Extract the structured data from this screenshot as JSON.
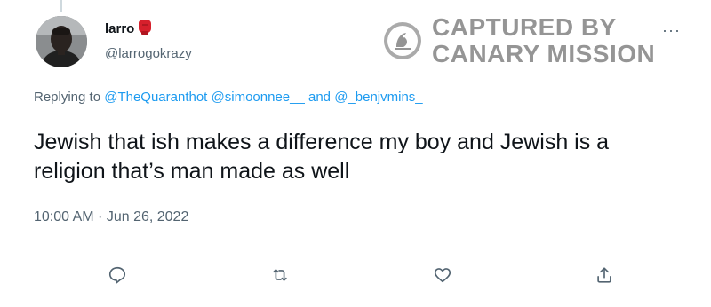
{
  "author": {
    "display_name": "larro",
    "emoji_icon": "boxing-glove-icon",
    "username": "@larrogokrazy"
  },
  "more_menu": {
    "glyph": "···"
  },
  "watermark": {
    "line1": "CAPTURED BY",
    "line2": "CANARY MISSION"
  },
  "reply_context": {
    "prefix": "Replying to ",
    "mention_1": "@TheQuaranthot",
    "mention_2": "@simoonnee__",
    "conjunction": " and ",
    "mention_3": "@_benjvmins_"
  },
  "tweet": {
    "text": "Jewish that ish makes a difference my boy and Jewish is a religion that’s man made as well",
    "timestamp": "10:00 AM · Jun 26, 2022"
  },
  "actions": {
    "reply_icon": "reply-icon",
    "retweet_icon": "retweet-icon",
    "like_icon": "heart-icon",
    "share_icon": "share-icon"
  },
  "colors": {
    "link": "#1d9bf0",
    "secondary_text": "#536471",
    "primary_text": "#0f1419",
    "glove_red": "#d6202c"
  }
}
